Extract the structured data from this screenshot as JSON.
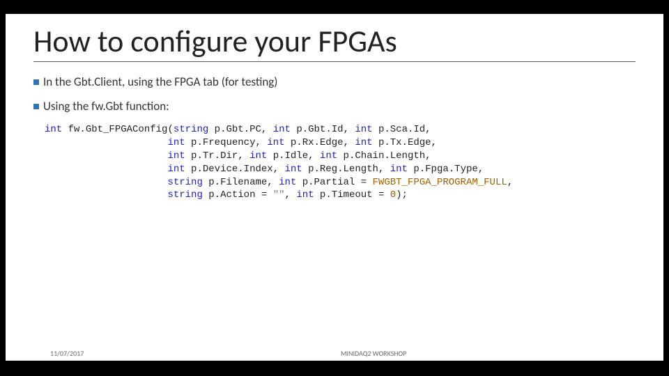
{
  "title": "How to configure your FPGAs",
  "bullets": [
    "In the Gbt.Client, using the FPGA tab (for testing)",
    "Using the fw.Gbt function:"
  ],
  "code": {
    "kw_int": "int",
    "kw_string": "string",
    "fn": " fw.Gbt_FPGAConfig(",
    "p_gbtpc": " p.Gbt.PC, ",
    "p_gbtid": " p.Gbt.Id, ",
    "p_scaid": " p.Sca.Id,",
    "indent": "                     ",
    "p_freq": " p.Frequency, ",
    "p_rxedge": " p.Rx.Edge, ",
    "p_txedge": " p.Tx.Edge,",
    "p_trdir": " p.Tr.Dir, ",
    "p_idle": " p.Idle, ",
    "p_chainlen": " p.Chain.Length,",
    "p_devidx": " p.Device.Index, ",
    "p_reglen": " p.Reg.Length, ",
    "p_fpgatype": " p.Fpga.Type,",
    "p_filename": " p.Filename, ",
    "p_partial": " p.Partial = ",
    "c_programfull": "FWGBT_FPGA_PROGRAM_FULL",
    "comma": ",",
    "p_action": " p.Action = ",
    "c_emptystr": "\"\"",
    "p_timeout": " p.Timeout = ",
    "c_zero": "0",
    "close": ");"
  },
  "footer": {
    "date": "11/07/2017",
    "mid": "MINIDAQ2 WORKSHOP"
  }
}
